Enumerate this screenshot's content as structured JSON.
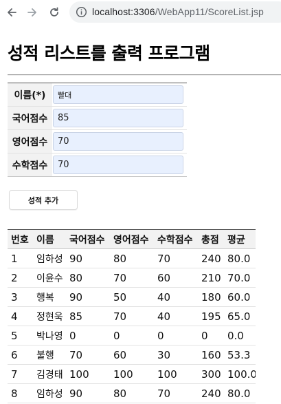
{
  "browser": {
    "url_host": "localhost:3306",
    "url_path": "/WebApp11/ScoreList.jsp"
  },
  "page": {
    "title": "성적 리스트를 출력 프로그램"
  },
  "form": {
    "fields": [
      {
        "label": "이름(*)",
        "value": "빨대"
      },
      {
        "label": "국어점수",
        "value": "85"
      },
      {
        "label": "영어점수",
        "value": "70"
      },
      {
        "label": "수학점수",
        "value": "70"
      }
    ],
    "submit_label": "성적 추가"
  },
  "score_table": {
    "headers": [
      "번호",
      "이름",
      "국어점수",
      "영어점수",
      "수학점수",
      "총점",
      "평균"
    ],
    "rows": [
      [
        "1",
        "임하성",
        "90",
        "80",
        "70",
        "240",
        "80.0"
      ],
      [
        "2",
        "이윤수",
        "80",
        "70",
        "60",
        "210",
        "70.0"
      ],
      [
        "3",
        "행복",
        "90",
        "50",
        "40",
        "180",
        "60.0"
      ],
      [
        "4",
        "정현욱",
        "85",
        "70",
        "40",
        "195",
        "65.0"
      ],
      [
        "5",
        "박나영",
        "0",
        "0",
        "0",
        "0",
        "0.0"
      ],
      [
        "6",
        "불행",
        "70",
        "60",
        "30",
        "160",
        "53.3"
      ],
      [
        "7",
        "김경태",
        "100",
        "100",
        "100",
        "300",
        "100.0"
      ],
      [
        "8",
        "임하성",
        "90",
        "80",
        "70",
        "240",
        "80.0"
      ]
    ]
  }
}
